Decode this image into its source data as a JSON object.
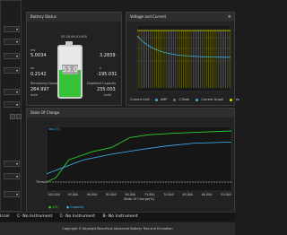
{
  "battery_status": {
    "title": "Battery Status",
    "date": "05.00.06:41.605",
    "voltage_label": "mv",
    "voltage_value": "5.0034",
    "current_value": "3.2839",
    "mid_left_small": "ns",
    "mid_left_value": "0.2142",
    "mid_right_small": "n",
    "mid_right_value": "-195.031",
    "remaining_label": "Remaining Capacity",
    "remaining_value": "264.997",
    "remaining_unit": "mAh",
    "depleted_label": "Depleted Capacity",
    "depleted_value": "235.003",
    "depleted_unit": "mAh",
    "percent": "53.0",
    "percent_value": 53.0,
    "fill_color": "#35c235"
  },
  "voltage_current": {
    "title": "Voltage and Current",
    "current_unit_label": "Current Unit :",
    "options": [
      "AMP",
      "C-Rate",
      "Current Graph",
      "Vo"
    ],
    "colors": {
      "voltage": "#e0e000",
      "current": "#3fb0d9"
    }
  },
  "state_of_charge": {
    "title": "State Of Charge",
    "x_axis_label": "State Of Charge(%)",
    "x_ticks": [
      "100.000",
      "95.000",
      "90.000",
      "85.000",
      "80.000",
      "75.000",
      "70.000",
      "65.000",
      "60.000",
      "55.000"
    ],
    "y_label_left": "Voo [V]",
    "threshold_label": "Thresh",
    "legend": [
      "SOC",
      "Capacity"
    ],
    "colors": {
      "soc": "#2ccf2c",
      "capacity": "#3fb6ff"
    }
  },
  "status_bar": {
    "items": [
      "Iccel",
      "C- No Instrument",
      "C- No Instrument",
      "B- No Instrument"
    ]
  },
  "footer": {
    "text": "Copyright © Keysight BenchVue Advanced Battery Test and Emulation"
  },
  "window": {
    "close_glyph": "×"
  }
}
